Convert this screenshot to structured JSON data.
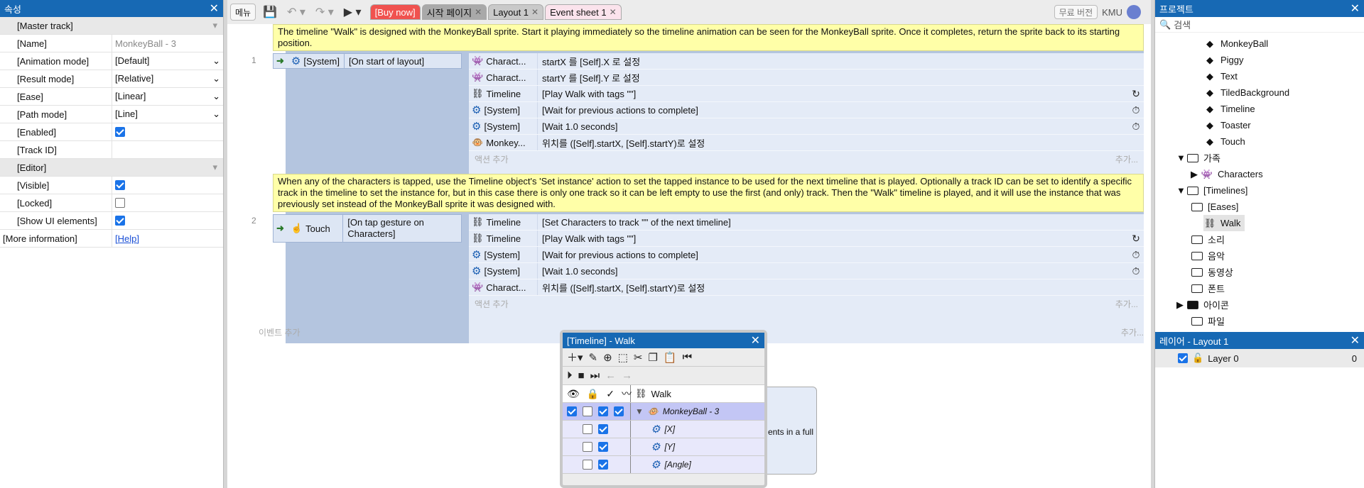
{
  "props": {
    "title": "속성",
    "rows": [
      {
        "k": "[Master track]",
        "group": true
      },
      {
        "k": "[Name]",
        "v": "MonkeyBall - 3",
        "dim": true
      },
      {
        "k": "[Animation mode]",
        "v": "[Default]",
        "select": true
      },
      {
        "k": "[Result mode]",
        "v": "[Relative]",
        "select": true
      },
      {
        "k": "[Ease]",
        "v": "[Linear]",
        "select": true
      },
      {
        "k": "[Path mode]",
        "v": "[Line]",
        "select": true
      },
      {
        "k": "[Enabled]",
        "check": true
      },
      {
        "k": "[Track ID]",
        "v": ""
      },
      {
        "k": "[Editor]",
        "group": true
      },
      {
        "k": "[Visible]",
        "check": true
      },
      {
        "k": "[Locked]",
        "check": false
      },
      {
        "k": "[Show UI elements]",
        "check": true
      }
    ],
    "more_label": "[More information]",
    "help_label": "[Help]"
  },
  "toolbar": {
    "menu": "메뉴",
    "badge": "무료 버전",
    "user": "KMU"
  },
  "tabs": [
    {
      "label": "[Buy now]",
      "bg": "#f0524f",
      "color": "#ffffff"
    },
    {
      "label": "시작 페이지",
      "bg": "#a9a9a9",
      "color": "#111111"
    },
    {
      "label": "Layout 1",
      "bg": "#c9c9c9",
      "color": "#111111"
    },
    {
      "label": "Event sheet 1",
      "bg": "#fbe3ec",
      "color": "#111111"
    }
  ],
  "events": [
    {
      "num": "1",
      "comment": "The timeline \"Walk\" is designed with the MonkeyBall sprite. Start it playing immediately so the timeline animation can be seen for the MonkeyBall sprite. Once it completes, return the sprite back to its starting position.",
      "cond_obj": "[System]",
      "cond_text": "[On start of layout]",
      "actions": [
        {
          "obj": "Charact...",
          "text": "startX 를 [Self].X 로 설정",
          "icon": ""
        },
        {
          "obj": "Charact...",
          "text": "startY 를 [Self].Y 로 설정",
          "icon": ""
        },
        {
          "obj": "Timeline",
          "text": "[Play Walk with tags \"\"]",
          "icon": "↻"
        },
        {
          "obj": "[System]",
          "text": "[Wait for previous actions to complete]",
          "icon": "⏱"
        },
        {
          "obj": "[System]",
          "text": "[Wait 1.0 seconds]",
          "icon": "⏱"
        },
        {
          "obj": "Monkey...",
          "text": "위치를 ([Self].startX, [Self].startY)로 설정",
          "icon": ""
        }
      ],
      "add_action": "액션 추가",
      "add_more": "추가..."
    },
    {
      "num": "2",
      "comment": "When any of the characters is tapped, use the Timeline object's 'Set instance' action to set the tapped instance to be used for the next timeline that is played. Optionally a track ID can be set to identify a specific track in the timeline to set the instance for, but in this case there is only one track so it can be left empty to use the first (and only) track. Then the \"Walk\" timeline is played, and it will use the instance that was previously set instead of the MonkeyBall sprite it was designed with.",
      "cond_obj": "Touch",
      "cond_text": "[On tap gesture on Characters]",
      "actions": [
        {
          "obj": "Timeline",
          "text": "[Set Characters to track \"\" of the next timeline]",
          "icon": ""
        },
        {
          "obj": "Timeline",
          "text": "[Play Walk with tags \"\"]",
          "icon": "↻"
        },
        {
          "obj": "[System]",
          "text": "[Wait for previous actions to complete]",
          "icon": "⏱"
        },
        {
          "obj": "[System]",
          "text": "[Wait 1.0 seconds]",
          "icon": "⏱"
        },
        {
          "obj": "Charact...",
          "text": "위치를 ([Self].startX, [Self].startY)로 설정",
          "icon": ""
        }
      ],
      "add_action": "액션 추가",
      "add_more": "추가..."
    }
  ],
  "add_event": "이벤트 추가",
  "add_event_more": "추가...",
  "project": {
    "title": "프로젝트",
    "search": "검색",
    "items": [
      {
        "label": "MonkeyBall",
        "kind": "obj"
      },
      {
        "label": "Piggy",
        "kind": "obj"
      },
      {
        "label": "Text",
        "kind": "obj"
      },
      {
        "label": "TiledBackground",
        "kind": "obj"
      },
      {
        "label": "Timeline",
        "kind": "obj"
      },
      {
        "label": "Toaster",
        "kind": "obj"
      },
      {
        "label": "Touch",
        "kind": "obj"
      },
      {
        "label": "가족",
        "kind": "folder-open"
      },
      {
        "label": "Characters",
        "kind": "family"
      },
      {
        "label": "[Timelines]",
        "kind": "folder-open"
      },
      {
        "label": "[Eases]",
        "kind": "folder"
      },
      {
        "label": "Walk",
        "kind": "timeline"
      },
      {
        "label": "소리",
        "kind": "folder"
      },
      {
        "label": "음악",
        "kind": "folder"
      },
      {
        "label": "동영상",
        "kind": "folder"
      },
      {
        "label": "폰트",
        "kind": "folder"
      },
      {
        "label": "아이콘",
        "kind": "folder-fill"
      },
      {
        "label": "파일",
        "kind": "folder"
      }
    ]
  },
  "layers": {
    "title": "레이어 - Layout 1",
    "layer": "Layer 0",
    "count": "0"
  },
  "timeline": {
    "title": "[Timeline] - Walk",
    "header": "Walk",
    "tracks": [
      {
        "label": "MonkeyBall - 3"
      },
      {
        "label": "[X]"
      },
      {
        "label": "[Y]"
      },
      {
        "label": "[Angle]"
      }
    ]
  },
  "popup_text": "ents in a full"
}
